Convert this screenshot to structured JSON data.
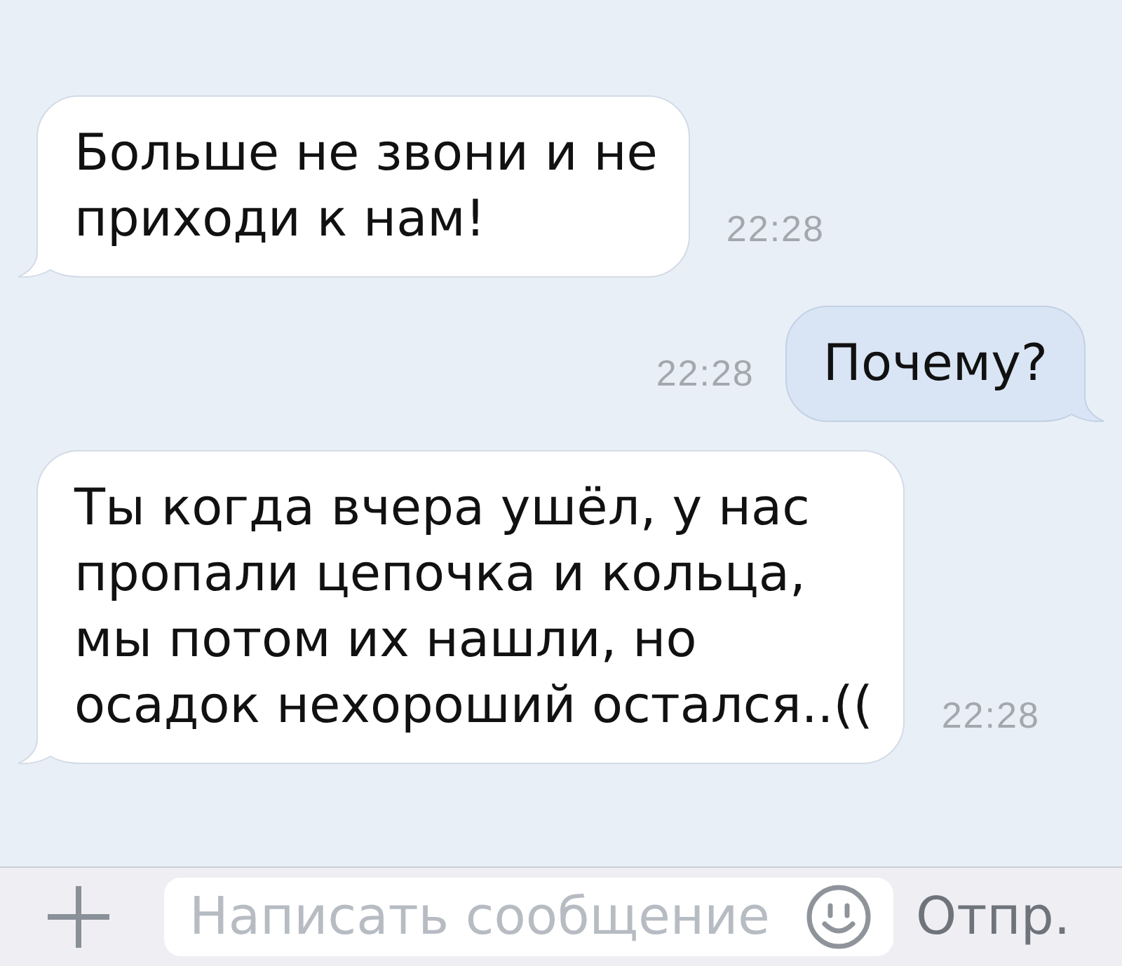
{
  "messages": [
    {
      "kind": "incoming",
      "lines": [
        "Больше не звони и не",
        "приходи к нам!"
      ],
      "time": "22:28"
    },
    {
      "kind": "outgoing",
      "lines": [
        "Почему?"
      ],
      "time": "22:28"
    },
    {
      "kind": "incoming",
      "lines": [
        "Ты когда вчера ушёл, у нас",
        "пропали цепочка и кольца,",
        "мы потом их нашли, но",
        "осадок нехороший остался..(("
      ],
      "time": "22:28"
    }
  ],
  "composer": {
    "placeholder": "Написать сообщение",
    "send_button": "Отпр."
  }
}
